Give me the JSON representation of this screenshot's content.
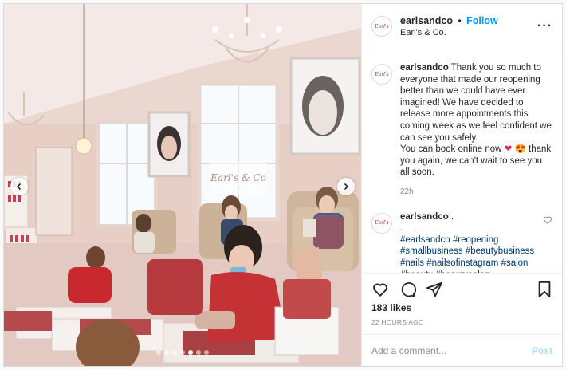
{
  "header": {
    "username": "earlsandco",
    "separator": "•",
    "follow_label": "Follow",
    "fullname": "Earl's & Co."
  },
  "caption": {
    "username": "earlsandco",
    "text_1": "Thank you so much to everyone that made our reopening better than we could have ever imagined! We have decided to release more appointments this coming week as we feel confident we can see you safely.",
    "text_2": "You can book online now",
    "emoji_1": "❤",
    "emoji_2": "😍",
    "text_3": "thank you again, we can't wait to see you all soon.",
    "timestamp": "22h"
  },
  "comment2": {
    "username": "earlsandco",
    "line_1": ".",
    "line_2": ".",
    "tags": "#earlsandco #reopening #smallbusiness #beautybusiness #nails #nailsofinstagram #salon #beauty #beautysalon #cheltenham"
  },
  "actions": {
    "likes": "183 likes",
    "date": "22 HOURS AGO"
  },
  "comment_box": {
    "placeholder": "Add a comment...",
    "post_label": "Post"
  },
  "media": {
    "frame_text": "Earl's & Co",
    "carousel_dots": 7,
    "active_dot": 4
  },
  "colors": {
    "follow": "#0095f6",
    "hashtag": "#00376b",
    "muted": "#8e8e8e",
    "post_disabled": "#b2dffc",
    "heart": "#e0245e"
  }
}
